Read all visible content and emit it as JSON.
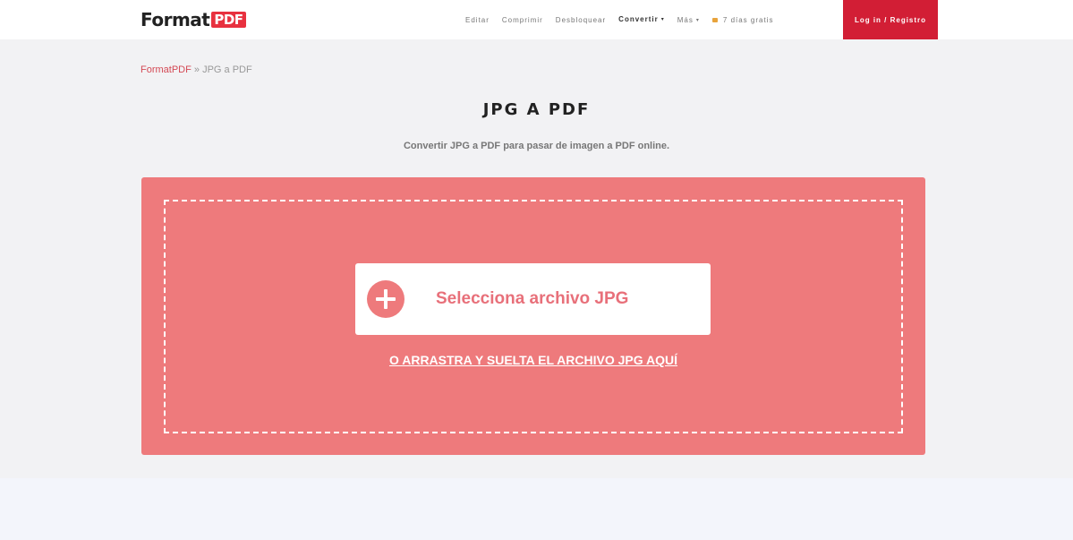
{
  "header": {
    "logo_text": "Format",
    "logo_badge": "PDF",
    "nav": [
      {
        "label": "Editar"
      },
      {
        "label": "Comprimir"
      },
      {
        "label": "Desbloquear"
      },
      {
        "label": "Convertir",
        "caret": "▾"
      },
      {
        "label": "Más",
        "caret": "▾"
      }
    ],
    "trial_label": "7 días gratis",
    "login_label": "Log in / Registro"
  },
  "breadcrumb": {
    "home": "FormatPDF",
    "separator": " » ",
    "current": "JPG a PDF"
  },
  "main": {
    "title": "JPG A PDF",
    "subtitle": "Convertir JPG a PDF para pasar de imagen a PDF online."
  },
  "upload": {
    "select_label": "Selecciona archivo JPG",
    "drag_text": "O ARRASTRA Y SUELTA EL ARCHIVO JPG AQUÍ"
  },
  "colors": {
    "brand_red": "#d21e35",
    "upload_bg": "#ee7a7c",
    "logo_badge": "#e8313f"
  }
}
